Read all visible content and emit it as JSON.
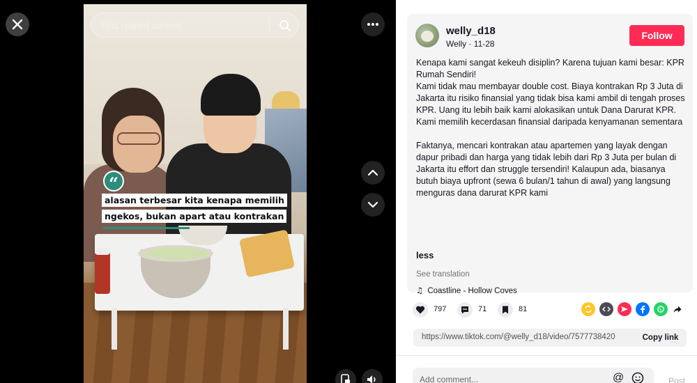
{
  "search": {
    "placeholder": "Find related content"
  },
  "video": {
    "caption_lines": [
      "alasan terbesar kita kenapa memilih",
      "ngekos, bukan apart atau kontrakan"
    ],
    "quote_mark": "“"
  },
  "author": {
    "username": "welly_d18",
    "display_name": "Welly",
    "date": "11-28",
    "separator": " · ",
    "follow_label": "Follow"
  },
  "description": {
    "lines": [
      "Kenapa kami sangat kekeuh disiplin? Karena tujuan kami besar: KPR Rumah Sendiri!",
      "Kami tidak mau membayar double cost. Biaya kontrakan Rp 3 Juta di Jakarta itu risiko finansial yang tidak bisa kami ambil di tengah proses KPR. Uang itu lebih baik kami alokasikan untuk Dana Darurat KPR.",
      "Kami memilih kecerdasan finansial daripada kenyamanan sementara",
      "",
      "Faktanya, mencari kontrakan atau apartemen yang layak dengan dapur pribadi dan harga yang tidak lebih dari Rp 3 Juta per bulan di Jakarta itu effort dan struggle tersendiri! Kalaupun ada, biasanya butuh biaya upfront (sewa 6 bulan/1 tahun di awal) yang langsung menguras dana darurat KPR kami"
    ],
    "less_label": "less",
    "see_translation": "See translation"
  },
  "music": {
    "title": "Coastline - Hollow Coves",
    "icon": "music-note-icon"
  },
  "stats": {
    "likes": "797",
    "comments": "71",
    "saves": "81"
  },
  "share_icons": [
    {
      "name": "repost-icon",
      "color": "#ffc629"
    },
    {
      "name": "embed-icon",
      "color": "#4b4b55"
    },
    {
      "name": "send-icon",
      "color": "#fe2c55"
    },
    {
      "name": "facebook-icon",
      "color": "#0075fa"
    },
    {
      "name": "whatsapp-icon",
      "color": "#25d366"
    },
    {
      "name": "share-arrow-icon",
      "color": "#161823"
    }
  ],
  "link": {
    "url": "https://www.tiktok.com/@welly_d18/video/7577738420",
    "copy_label": "Copy link"
  },
  "comment": {
    "placeholder": "Add comment...",
    "at_symbol": "@",
    "post_label": "Post"
  },
  "colors": {
    "accent": "#fe2c55",
    "caption_bar": "#2e8d7a"
  }
}
